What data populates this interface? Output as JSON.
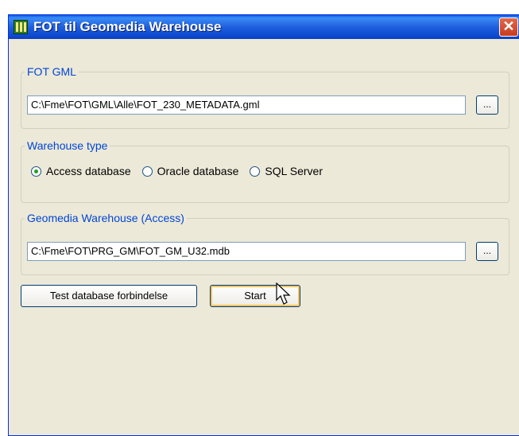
{
  "window": {
    "title": "FOT til Geomedia Warehouse",
    "close_symbol": "✕"
  },
  "fot_gml": {
    "legend": "FOT GML",
    "value": "C:\\Fme\\FOT\\GML\\Alle\\FOT_230_METADATA.gml",
    "browse_label": "..."
  },
  "warehouse_type": {
    "legend": "Warehouse type",
    "options": [
      {
        "label": "Access database",
        "checked": true
      },
      {
        "label": "Oracle database",
        "checked": false
      },
      {
        "label": "SQL Server",
        "checked": false
      }
    ]
  },
  "geomedia": {
    "legend": "Geomedia Warehouse (Access)",
    "value": "C:\\Fme\\FOT\\PRG_GM\\FOT_GM_U32.mdb",
    "browse_label": "..."
  },
  "buttons": {
    "test_label": "Test database forbindelse",
    "start_label": "Start"
  }
}
